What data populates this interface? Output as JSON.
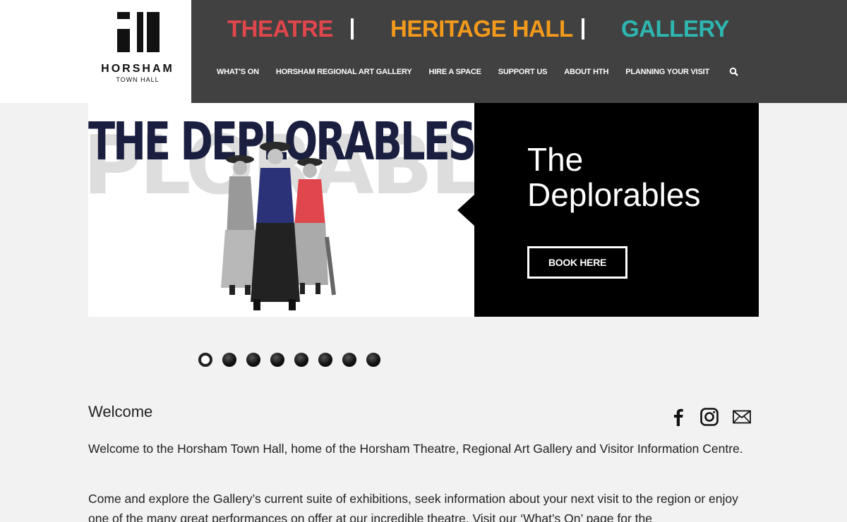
{
  "logo": {
    "name": "HORSHAM",
    "sub": "TOWN HALL"
  },
  "venues": [
    {
      "label": "THEATRE",
      "color": "#e0474c"
    },
    {
      "label": "HERITAGE HALL",
      "color": "#f39a1c"
    },
    {
      "label": "GALLERY",
      "color": "#2eb6b0"
    }
  ],
  "nav": {
    "items": [
      "WHAT'S ON",
      "HORSHAM REGIONAL ART GALLERY",
      "HIRE A SPACE",
      "SUPPORT US",
      "ABOUT HTH",
      "PLANNING YOUR VISIT"
    ],
    "search_icon": "search-icon"
  },
  "hero": {
    "image_text": "THE DEPLORABLES",
    "title": "The Deplorables",
    "button": "BOOK HERE"
  },
  "carousel": {
    "slide_count": 8,
    "active_index": 0
  },
  "welcome": {
    "title": "Welcome",
    "para1": "Welcome to the Horsham Town Hall, home of the Horsham Theatre, Regional Art Gallery and Visitor Information Centre.",
    "para2": "Come and explore the Gallery’s current suite of exhibitions, seek information about your next visit to the region or enjoy one of the many great performances on offer at our incredible theatre. Visit our ‘What’s On’ page for the"
  },
  "social": [
    "facebook-icon",
    "instagram-icon",
    "email-icon"
  ]
}
